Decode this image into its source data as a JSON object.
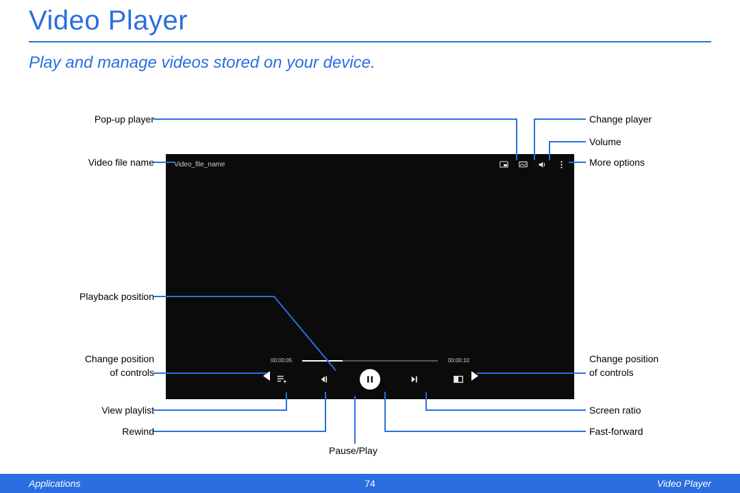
{
  "page": {
    "title": "Video Player",
    "subtitle": "Play and manage videos stored on your device.",
    "footer_left": "Applications",
    "footer_page": "74",
    "footer_right": "Video Player"
  },
  "player": {
    "video_file_name": "Video_file_name",
    "elapsed": "00:00:05",
    "duration": "00:00:10"
  },
  "labels": {
    "pop_up_player": "Pop-up player",
    "video_file_name": "Video file name",
    "playback_position": "Playback position",
    "change_position_l1": "Change position",
    "change_position_l2": "of controls",
    "view_playlist": "View playlist",
    "rewind": "Rewind",
    "pause_play": "Pause/Play",
    "change_player": "Change player",
    "volume": "Volume",
    "more_options": "More options",
    "change_position_r1": "Change position",
    "change_position_r2": "of controls",
    "screen_ratio": "Screen ratio",
    "fast_forward": "Fast-forward"
  }
}
